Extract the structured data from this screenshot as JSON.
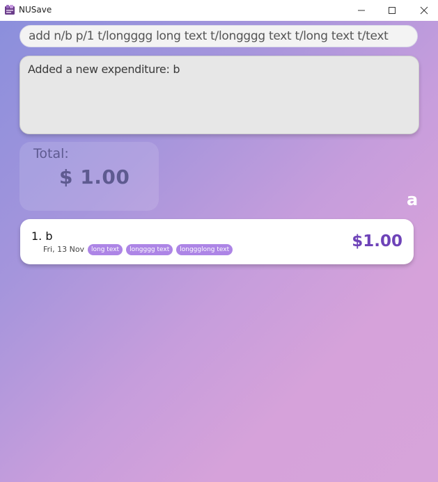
{
  "window": {
    "title": "NUSave",
    "icon": "nusave-app-icon",
    "controls": [
      "minimize-icon",
      "maximize-icon",
      "close-icon"
    ]
  },
  "command_box": {
    "value": "add n/b p/1 t/longggg long text t/longggg text t/long text t/text"
  },
  "result_display": {
    "text": "Added a new expenditure: b"
  },
  "total": {
    "label": "Total:",
    "value": "$ 1.00"
  },
  "budget": {
    "name": "a"
  },
  "expenditures": [
    {
      "title": "1. b",
      "date": "Fri, 13 Nov",
      "tags": [
        "long text",
        "longggg text",
        "longgglong text"
      ],
      "amount": "$1.00"
    }
  ],
  "colors": {
    "background_start": "#8b8fdc",
    "background_end": "#d7a4da",
    "tag": "#ad85e6",
    "amount": "#6e43b8",
    "total_text": "#5e5a90"
  }
}
